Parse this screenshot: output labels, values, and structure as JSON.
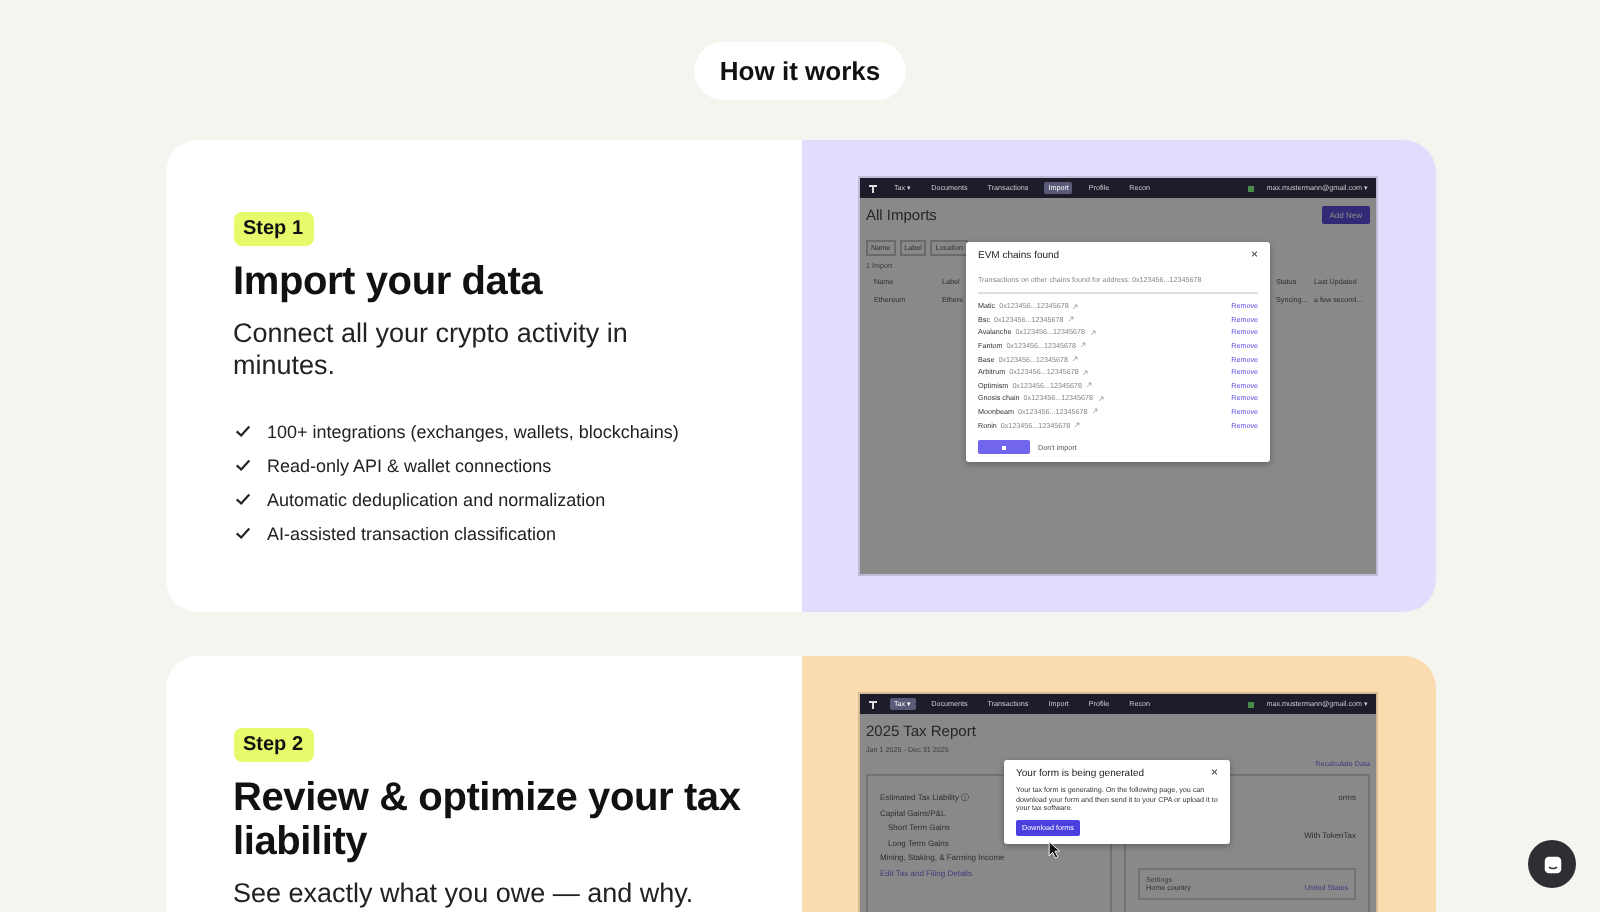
{
  "section_label": "How it works",
  "steps": [
    {
      "badge": "Step 1",
      "title": "Import your data",
      "subtitle": "Connect all your crypto activity in minutes.",
      "color": "#e4dcfc",
      "features": [
        "100+ integrations (exchanges, wallets, blockchains)",
        "Read-only API & wallet connections",
        "Automatic deduplication and normalization",
        "AI-assisted transaction classification"
      ],
      "mockup": {
        "kind": "imports",
        "nav": [
          {
            "label": "Tax ▾",
            "selected": false
          },
          {
            "label": "Documents",
            "selected": false
          },
          {
            "label": "Transactions",
            "selected": false
          },
          {
            "label": "Import",
            "selected": true
          },
          {
            "label": "Profile",
            "selected": false
          },
          {
            "label": "Recon",
            "selected": false
          }
        ],
        "account": "max.mustermann@gmail.com ▾",
        "page_title": "All Imports",
        "primary_button": "Add New",
        "filters": [
          "Name",
          "Label",
          "Location"
        ],
        "count": "1 Import",
        "columns": [
          "Name",
          "Label",
          "Status",
          "Last Updated"
        ],
        "row": [
          "Ethereum",
          "Ethere",
          "Syncing...",
          "a few second..."
        ],
        "modal": {
          "title": "EVM chains found",
          "close": "×",
          "description": "Transactions on other chains found for address: 0x123456...12345678",
          "chains": [
            {
              "name": "Matic",
              "address": "0x123456...12345678",
              "action": "Remove"
            },
            {
              "name": "Bsc",
              "address": "0x123456...12345678",
              "action": "Remove"
            },
            {
              "name": "Avalanche",
              "address": "0x123456...12345678",
              "action": "Remove"
            },
            {
              "name": "Fantom",
              "address": "0x123456...12345678",
              "action": "Remove"
            },
            {
              "name": "Base",
              "address": "0x123456...12345678",
              "action": "Remove"
            },
            {
              "name": "Arbitrum",
              "address": "0x123456...12345678",
              "action": "Remove"
            },
            {
              "name": "Optimism",
              "address": "0x123456...12345678",
              "action": "Remove"
            },
            {
              "name": "Gnosis chain",
              "address": "0x123456...12345678",
              "action": "Remove"
            },
            {
              "name": "Moonbeam",
              "address": "0x123456...12345678",
              "action": "Remove"
            },
            {
              "name": "Ronin",
              "address": "0x123456...12345678",
              "action": "Remove"
            }
          ],
          "secondary_button": "Don't import"
        }
      }
    },
    {
      "badge": "Step 2",
      "title": "Review & optimize your tax liability",
      "subtitle": "See exactly what you owe — and why.",
      "color": "#fbdcb0",
      "mockup": {
        "kind": "report",
        "nav": [
          {
            "label": "Tax ▾",
            "selected": true
          },
          {
            "label": "Documents",
            "selected": false
          },
          {
            "label": "Transactions",
            "selected": false
          },
          {
            "label": "Import",
            "selected": false
          },
          {
            "label": "Profile",
            "selected": false
          },
          {
            "label": "Recon",
            "selected": false
          }
        ],
        "account": "max.mustermann@gmail.com ▾",
        "page_title": "2025 Tax Report",
        "date_range": "Jan 1 2025 - Dec 31 2025",
        "recalculate": "Recalculate Data",
        "summary": [
          "Estimated Tax Liability ⓘ",
          "Capital Gains/P&L",
          "Short Term Gains",
          "Long Term Gains",
          "Mining, Staking, & Farming Income"
        ],
        "edit_link": "Edit Tax and Filing Details",
        "right_items": [
          "orms",
          "With TokenTax"
        ],
        "settings": "Settings",
        "setting_label": "Home country",
        "setting_value": "United States",
        "modal": {
          "title": "Your form is being generated",
          "close": "×",
          "description": "Your tax form is generating. On the following page, you can download your form and then send it to your CPA or upload it to your tax software.",
          "button": "Download forms"
        }
      }
    }
  ]
}
